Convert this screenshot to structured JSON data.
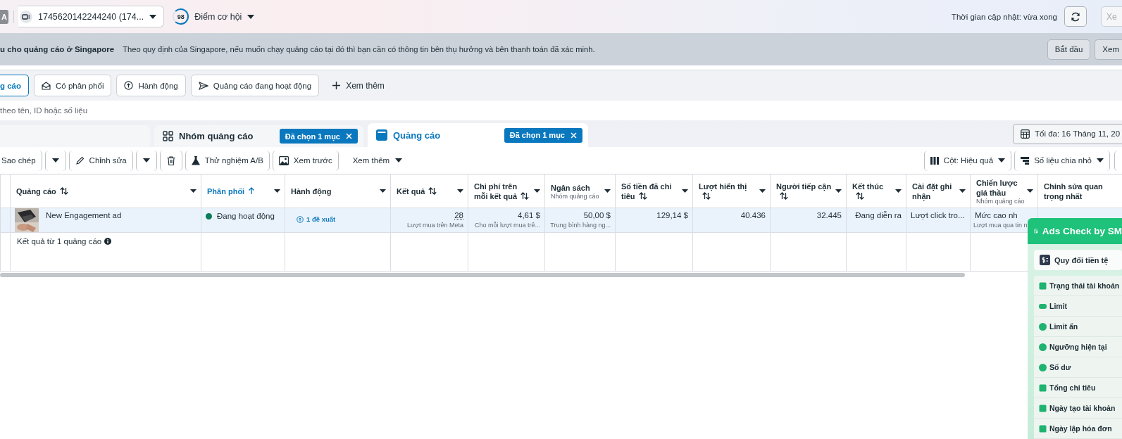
{
  "top_bar": {
    "account_badge": "A",
    "account": "1745620142244240 (174...",
    "score": "98",
    "score_label": "Điểm cơ hội",
    "updated": "Thời gian cập nhật: vừa xong",
    "edge_button": "Xe"
  },
  "banner": {
    "title": "u cho quảng cáo ở Singapore",
    "text": "Theo quy định của Singapore, nếu muốn chạy quảng cáo tại đó thì bạn cần có thông tin bên thụ hưởng và bên thanh toán đã xác minh.",
    "buttons": [
      "Bắt đầu",
      "Xem"
    ]
  },
  "filters": [
    {
      "label": "g cáo",
      "selected": true
    },
    {
      "label": "Có phân phối",
      "selected": false
    },
    {
      "label": "Hành động",
      "selected": false
    },
    {
      "label": "Quảng cáo đang hoạt động",
      "selected": false
    }
  ],
  "more_filters": "Xem thêm",
  "search": {
    "placeholder": "theo tên, ID hoặc số liệu"
  },
  "level_tabs": [
    {
      "label": "Nhóm quảng cáo",
      "chip": "Đã chọn 1 mục",
      "selected": false
    },
    {
      "label": "Quảng cáo",
      "chip": "Đã chọn 1 mục",
      "selected": true
    }
  ],
  "date_range": "Tối đa: 16 Tháng 11, 20",
  "toolbar": [
    {
      "kind": "button",
      "label": "Sao chép"
    },
    {
      "kind": "caret"
    },
    {
      "kind": "button",
      "label": "Chỉnh sửa"
    },
    {
      "kind": "caret"
    },
    {
      "kind": "icon"
    },
    {
      "kind": "button",
      "label": "Thử nghiệm A/B"
    },
    {
      "kind": "button",
      "label": "Xem trước"
    },
    {
      "kind": "menu",
      "label": "Xem thêm"
    }
  ],
  "toolbar_right": [
    "Cột: Hiệu quả",
    "Số liệu chia nhỏ"
  ],
  "table": {
    "columns": [
      {
        "label": "Quảng cáo",
        "sortable": true,
        "sorted": false
      },
      {
        "label": "Phân phối",
        "sortable": true,
        "sorted": true
      },
      {
        "label": "Hành động",
        "sortable": false,
        "sorted": false
      },
      {
        "label": "Kết quả",
        "sortable": true,
        "sorted": false
      },
      {
        "label": "Chi phí trên mỗi kết quả",
        "sortable": true,
        "sorted": false
      },
      {
        "label": "Ngân sách",
        "sub": "Nhóm quảng cáo",
        "sortable": false,
        "sorted": false
      },
      {
        "label": "Số tiền đã chi tiêu",
        "sortable": true,
        "sorted": false
      },
      {
        "label": "Lượt hiển thị",
        "sortable": true,
        "sorted": false
      },
      {
        "label": "Người tiếp cận",
        "sortable": true,
        "sorted": false
      },
      {
        "label": "Kết thúc",
        "sortable": true,
        "sorted": false
      },
      {
        "label": "Cài đặt ghi nhận",
        "sortable": false,
        "sorted": false
      },
      {
        "label": "Chiến lược giá thầu",
        "sub": "Nhóm quảng cáo",
        "sortable": false,
        "sorted": false
      },
      {
        "label": "Chỉnh sửa quan trọng nhất",
        "sortable": false,
        "sorted": false
      }
    ],
    "rows": [
      {
        "selected": true,
        "cells": [
          {
            "kind": "ad",
            "text": "New Engagement ad"
          },
          {
            "kind": "status",
            "text": "Đang hoạt động",
            "color": "#0a7c59"
          },
          {
            "kind": "link",
            "text": "1 đề xuất"
          },
          {
            "kind": "number",
            "text": "28",
            "sub": "Lượt mua trên Meta"
          },
          {
            "kind": "number",
            "text": "4,61 $",
            "sub": "Cho mỗi lượt mua trê..."
          },
          {
            "kind": "number",
            "text": "50,00 $",
            "sub": "Trung bình hàng ng..."
          },
          {
            "kind": "number",
            "text": "129,14 $"
          },
          {
            "kind": "number",
            "text": "40.436"
          },
          {
            "kind": "number",
            "text": "32.445"
          },
          {
            "kind": "number",
            "text": "Đang diễn ra"
          },
          {
            "kind": "text",
            "text": "Lượt click tro..."
          },
          {
            "kind": "text",
            "text": "Mức cao nh",
            "sub": "Lượt mua qua tin n"
          }
        ]
      }
    ],
    "summary": "Kết quả từ 1 quảng cáo"
  },
  "panel": {
    "title": "Ads Check by SM",
    "convert": "Quy đổi tiền tệ",
    "items": [
      "Trạng thái tài khoản",
      "Limit",
      "Limit ẩn",
      "Ngưỡng hiện tại",
      "Số dư",
      "Tổng chi tiêu",
      "Ngày tạo tài khoản",
      "Ngày lập hóa đơn"
    ]
  }
}
